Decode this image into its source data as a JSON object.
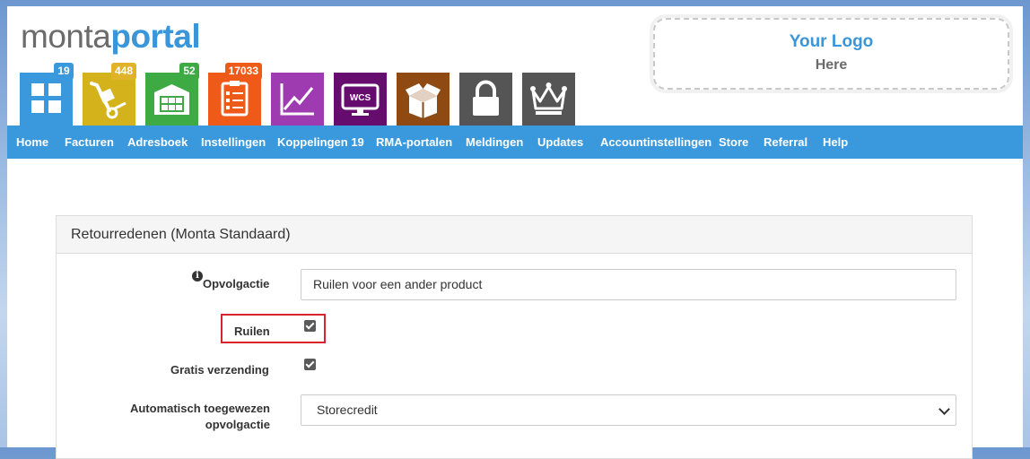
{
  "brand": {
    "part1": "monta",
    "part2": "portal"
  },
  "placeholder_logo": {
    "line1": "Your Logo",
    "line2": "Here"
  },
  "tiles": [
    {
      "icon": "dashboard-icon",
      "color": "#3a99dd",
      "badge": "19",
      "badge_color": "#3a99dd"
    },
    {
      "icon": "hand-truck-icon",
      "color": "#d4b21b",
      "badge": "448",
      "badge_color": "#e0b32a"
    },
    {
      "icon": "warehouse-icon",
      "color": "#3daa43",
      "badge": "52",
      "badge_color": "#3daa43"
    },
    {
      "icon": "clipboard-icon",
      "color": "#f05a19",
      "badge": "17033",
      "badge_color": "#f05a19"
    },
    {
      "icon": "chart-icon",
      "color": "#9f3bb0",
      "badge": "",
      "badge_color": ""
    },
    {
      "icon": "wcs-monitor-icon",
      "color": "#650c6e",
      "badge": "",
      "badge_color": "",
      "text": "WCS"
    },
    {
      "icon": "open-box-icon",
      "color": "#8e4a12",
      "badge": "",
      "badge_color": ""
    },
    {
      "icon": "lock-icon",
      "color": "#555555",
      "badge": "",
      "badge_color": ""
    },
    {
      "icon": "crown-icon",
      "color": "#555555",
      "badge": "",
      "badge_color": ""
    }
  ],
  "nav": [
    "Home",
    "Facturen",
    "Adresboek",
    "Instellingen",
    "Koppelingen 19",
    "RMA-portalen",
    "Meldingen",
    "Updates",
    "Accountinstellingen",
    "Store",
    "Referral",
    "Help"
  ],
  "panel": {
    "title": "Retourredenen (Monta Standaard)",
    "fields": {
      "opvolgactie_label": "Opvolgactie",
      "opvolgactie_value": "Ruilen voor een ander product",
      "ruilen_label": "Ruilen",
      "ruilen_checked": true,
      "gratis_label": "Gratis verzending",
      "gratis_checked": true,
      "auto_label_line1": "Automatisch toegewezen",
      "auto_label_line2": "opvolgactie",
      "auto_value": "Storecredit"
    }
  }
}
